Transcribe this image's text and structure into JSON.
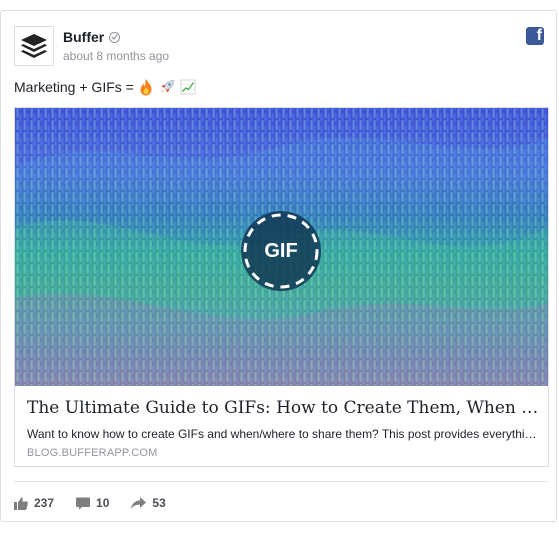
{
  "post": {
    "page_name": "Buffer",
    "timestamp": "about 8 months ago",
    "text": "Marketing + GIFs =",
    "emojis": [
      "fire",
      "rocket",
      "chart-increasing"
    ]
  },
  "link": {
    "badge_text": "GIF",
    "title": "The Ultimate Guide to GIFs: How to Create Them, When to Use Them, and Why They Work",
    "description": "Want to know how to create GIFs and when/where to share them? This post provides everything you need.",
    "domain": "BLOG.BUFFERAPP.COM"
  },
  "stats": {
    "likes": "237",
    "comments": "10",
    "shares": "53"
  },
  "colors": {
    "facebook_blue": "#3b5998",
    "text_primary": "#1d2129",
    "text_secondary": "#90949c"
  }
}
